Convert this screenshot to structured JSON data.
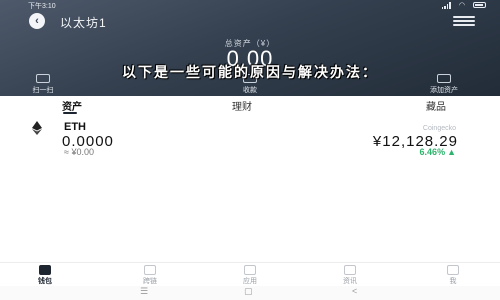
{
  "status_bar": {
    "time": "下午3:10",
    "wifi_icon": "wifi-icon",
    "signal_icon": "signal-icon",
    "battery_icon": "battery-icon"
  },
  "header": {
    "back_icon": "back-arrow-icon",
    "wallet_name": "以太坊1",
    "menu_icon": "menu-icon"
  },
  "asset_summary": {
    "label": "总资产（¥）",
    "amount": "0.00"
  },
  "overlay_caption": "以下是一些可能的原因与解决办法：",
  "quick_actions": [
    {
      "label": "扫一扫",
      "icon": "scan-icon"
    },
    {
      "label": "收款",
      "icon": "receive-icon"
    },
    {
      "label": "添加资产",
      "icon": "add-asset-icon"
    }
  ],
  "tabs": [
    {
      "label": "资产",
      "active": true
    },
    {
      "label": "理财",
      "active": false
    },
    {
      "label": "藏品",
      "active": false
    }
  ],
  "coins": [
    {
      "symbol": "ETH",
      "icon": "eth-icon",
      "balance": "0.0000",
      "fiat_value": "≈ ¥0.00",
      "source": "Coingecko",
      "price": "¥12,128.29",
      "change": "6.46%",
      "change_color": "#2db36b"
    }
  ],
  "bottom_nav": [
    {
      "label": "钱包",
      "icon": "wallet-icon",
      "active": true
    },
    {
      "label": "跨链",
      "icon": "cross-chain-icon",
      "active": false
    },
    {
      "label": "应用",
      "icon": "apps-icon",
      "active": false
    },
    {
      "label": "资讯",
      "icon": "news-icon",
      "active": false
    },
    {
      "label": "我",
      "icon": "profile-icon",
      "active": false
    }
  ],
  "system_nav": {
    "menu": "☰",
    "home": "▢",
    "back": "<"
  },
  "colors": {
    "hero_bg": "#34404f",
    "positive": "#2db36b",
    "active_nav": "#1d2530"
  }
}
